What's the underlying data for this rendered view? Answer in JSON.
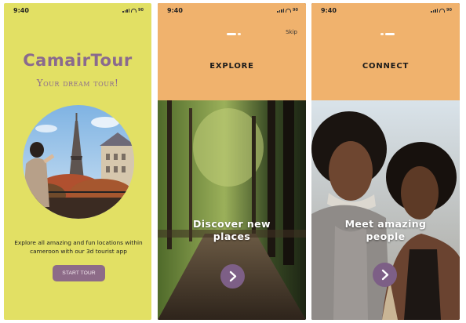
{
  "status_bar": {
    "time": "9:40",
    "battery": "90"
  },
  "welcome": {
    "brand_first": "Camair",
    "brand_second": "Tour",
    "tagline": "Your dream tour!",
    "description_line1": "Explore all amazing and fun locations within",
    "description_line2": "cameroon with our 3d tourist app",
    "start_label": "START TOUR"
  },
  "explore": {
    "skip_label": "Skip",
    "title": "EXPLORE",
    "caption_line1": "Discover new",
    "caption_line2": "places"
  },
  "connect": {
    "title": "CONNECT",
    "caption_line1": "Meet amazing",
    "caption_line2": "people"
  },
  "icons": {
    "next": "chevron-right-icon",
    "signal": "signal-icon",
    "wifi": "wifi-icon",
    "battery": "battery-icon"
  },
  "colors": {
    "welcome_bg": "#e2e064",
    "brand": "#8a6a8e",
    "header_bg": "#f0b26d",
    "button": "#8d6b88",
    "next_button": "#7d5f86"
  },
  "pager": {
    "explore_active": 1,
    "connect_active": 2,
    "count": 3
  }
}
